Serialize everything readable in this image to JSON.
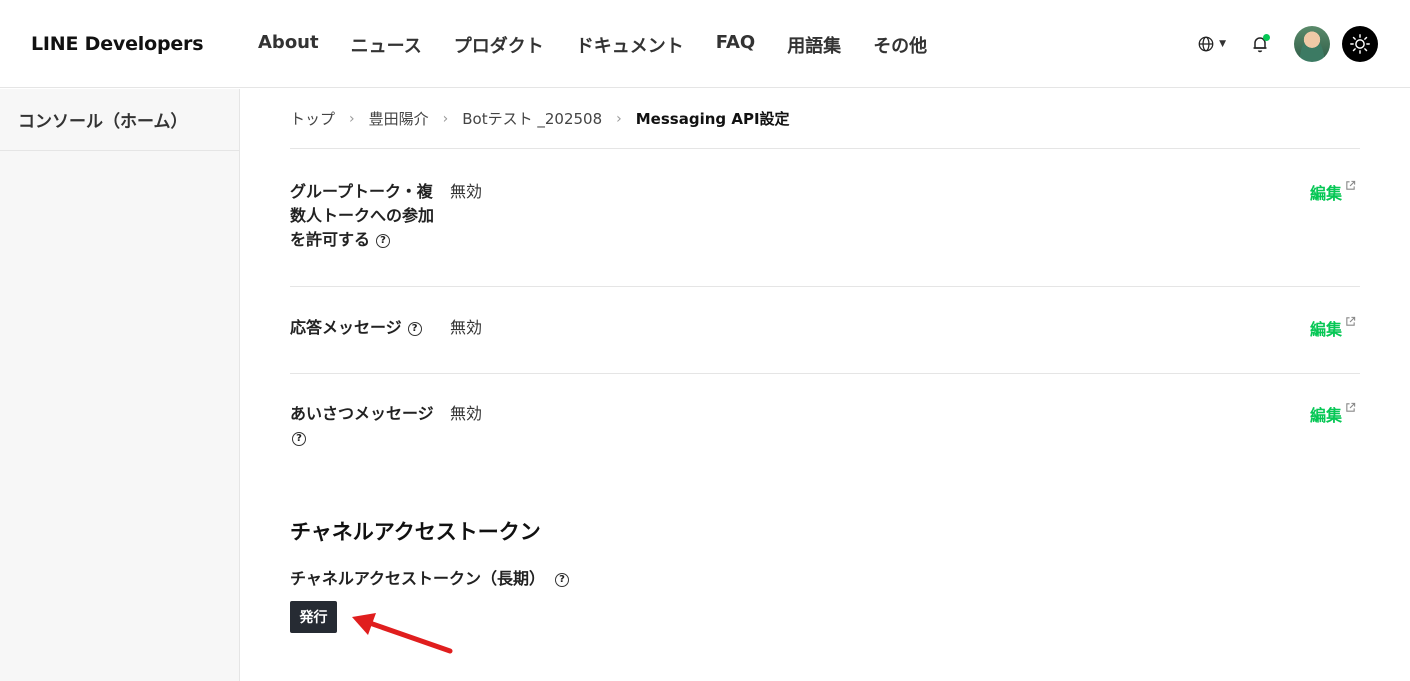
{
  "header": {
    "logo": "LINE Developers",
    "nav": [
      "About",
      "ニュース",
      "プロダクト",
      "ドキュメント",
      "FAQ",
      "用語集",
      "その他"
    ],
    "icons": [
      "globe-icon",
      "bell-icon",
      "avatar",
      "sun-icon"
    ],
    "notification_dot_color": "#06c755"
  },
  "sidebar": {
    "items": [
      {
        "label": "コンソール（ホーム）"
      }
    ]
  },
  "breadcrumb": {
    "items": [
      "トップ",
      "豊田陽介",
      "Botテスト _202508",
      "Messaging API設定"
    ]
  },
  "settings": [
    {
      "label_lines": [
        "グループトーク・複",
        "数人トークへの参加",
        "を許可する"
      ],
      "value": "無効",
      "edit": "編集"
    },
    {
      "label_lines": [
        "応答メッセージ"
      ],
      "value": "無効",
      "edit": "編集"
    },
    {
      "label_lines": [
        "あいさつメッセージ"
      ],
      "value": "無効",
      "edit": "編集"
    }
  ],
  "token_section": {
    "title": "チャネルアクセストークン",
    "subtitle": "チャネルアクセストークン（長期）",
    "button": "発行"
  },
  "colors": {
    "accent": "#06c755",
    "button_bg": "#262b33",
    "arrow": "#e01e1e"
  }
}
